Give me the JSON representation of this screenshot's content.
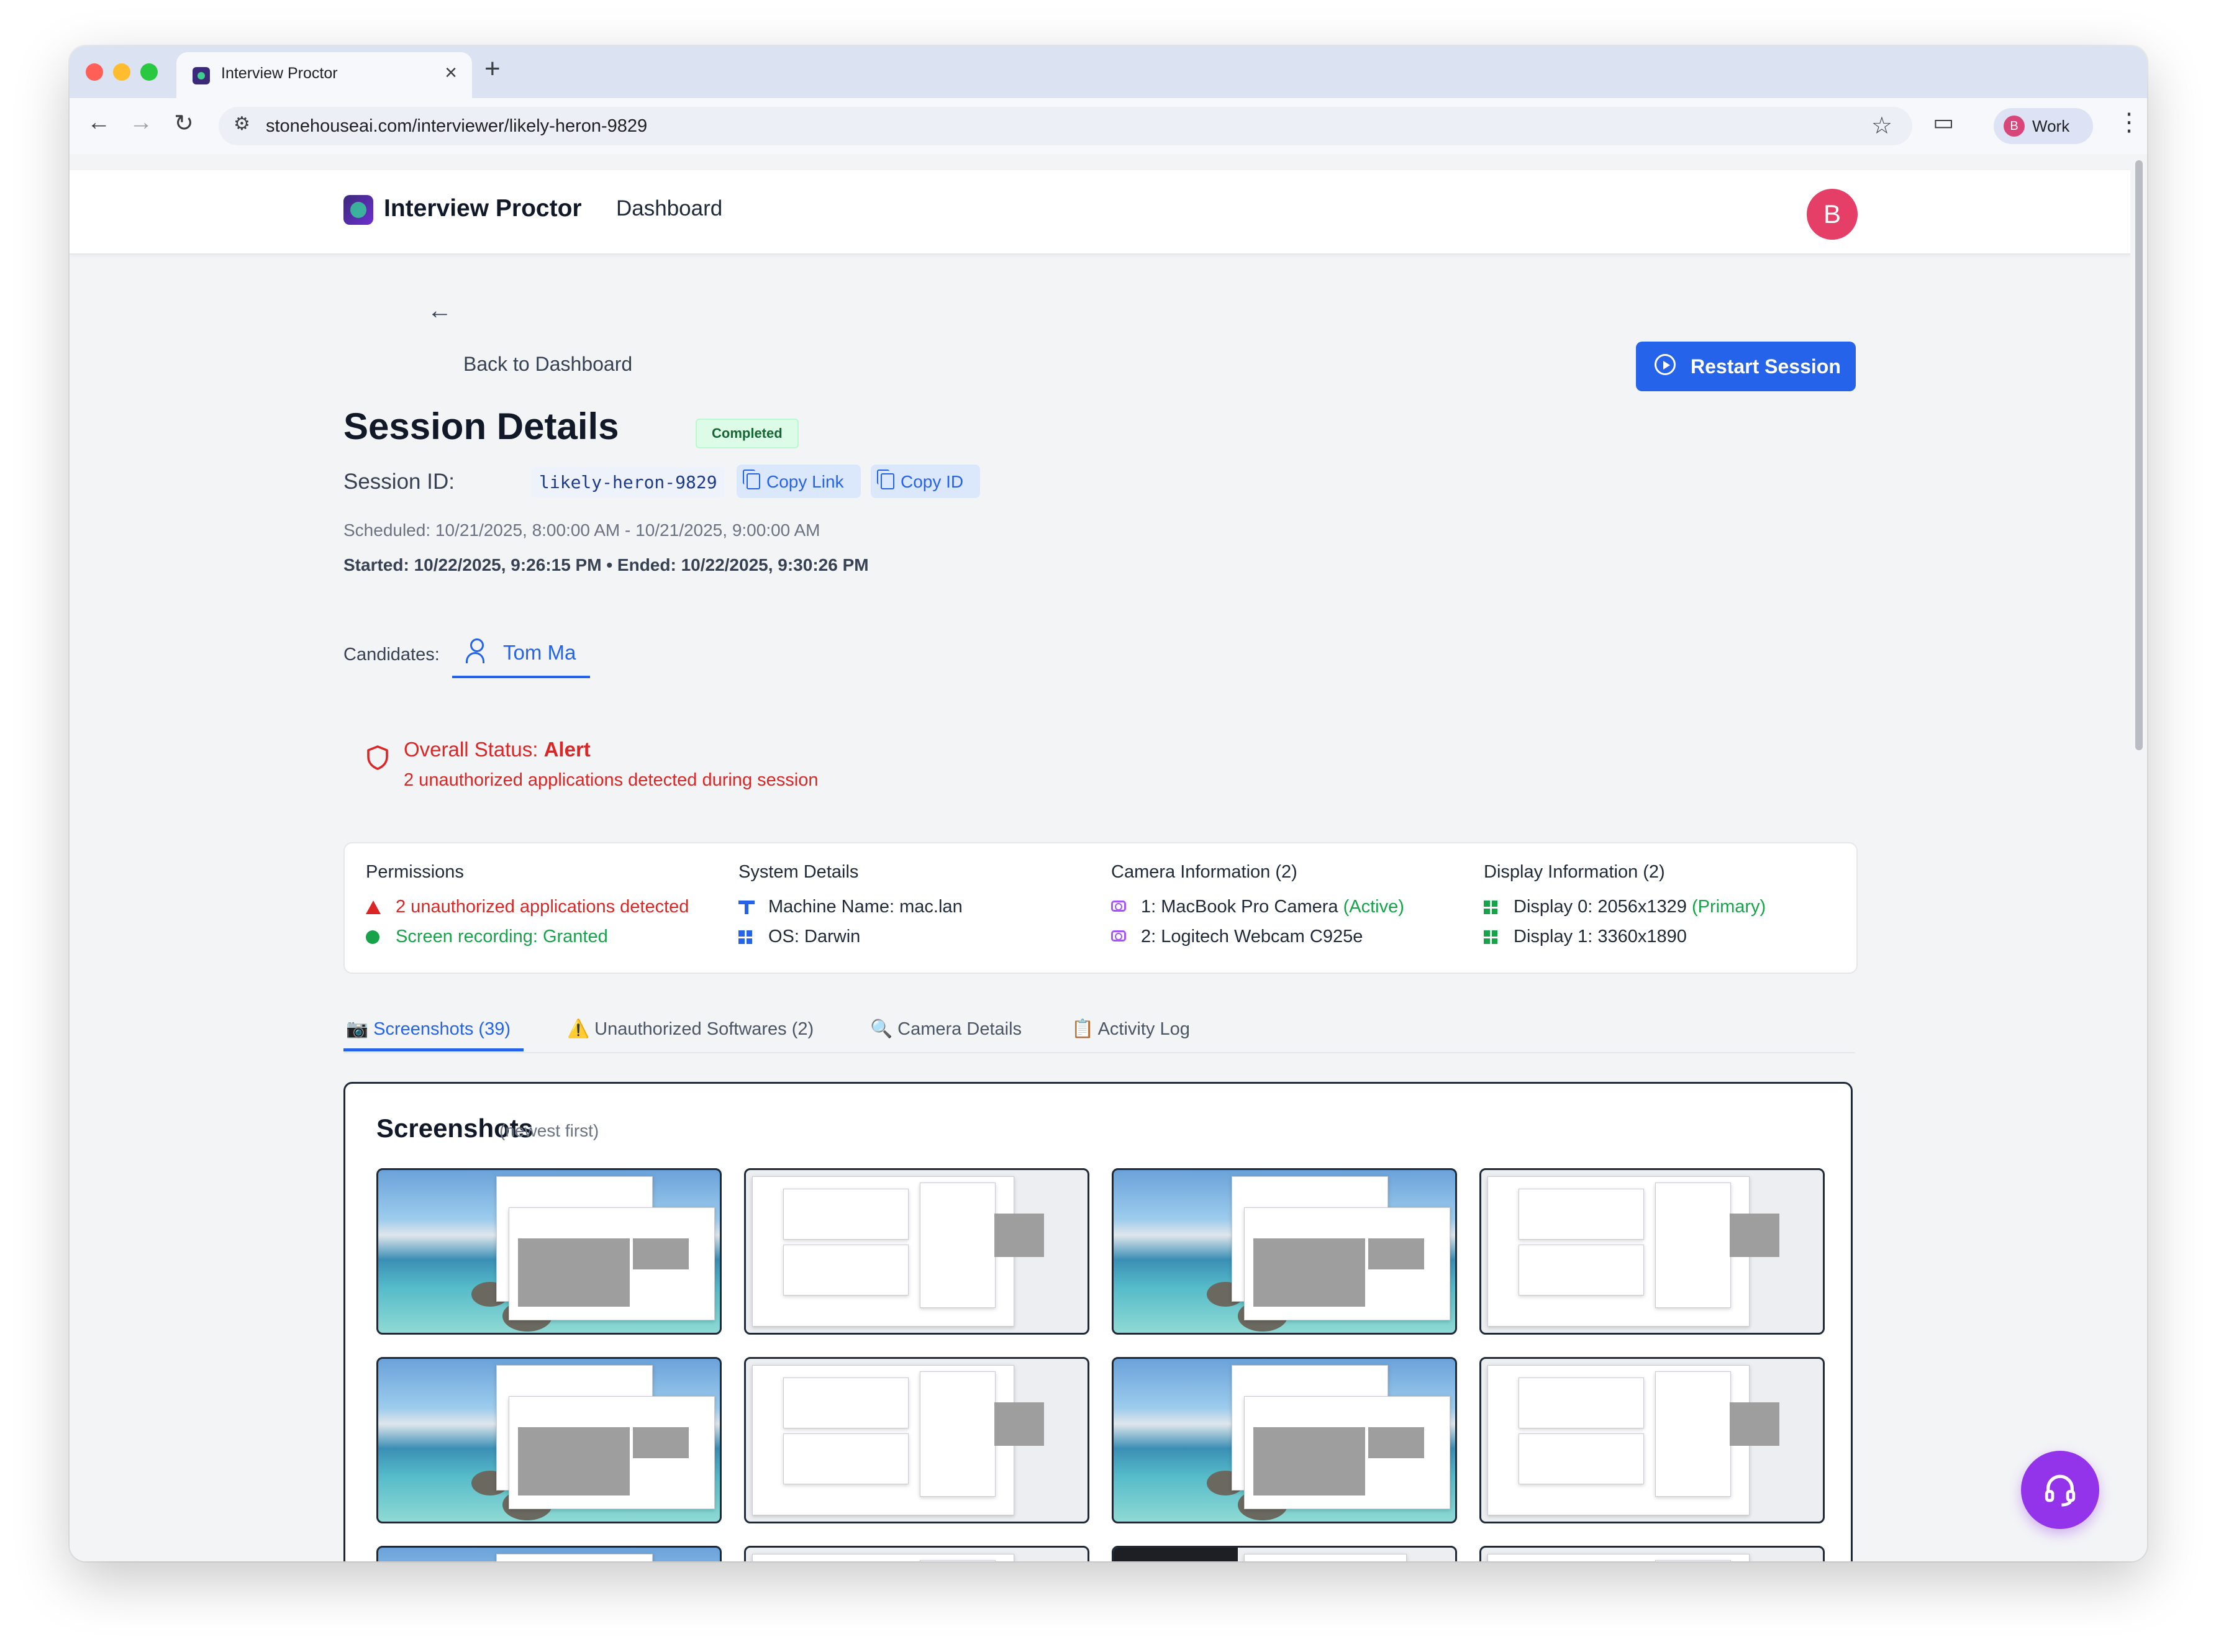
{
  "browser": {
    "tab_title": "Interview Proctor",
    "new_tab": "+",
    "close": "×",
    "url": "stonehouseai.com/interviewer/likely-heron-9829",
    "profile_initial": "B",
    "profile_label": "Work",
    "colors": {
      "close": "#ff5f57",
      "minimize": "#febc2e",
      "maximize": "#28c840"
    }
  },
  "app": {
    "name": "Interview Proctor",
    "nav": "Dashboard",
    "user_initial": "B"
  },
  "header": {
    "back_label": "Back to Dashboard",
    "restart_label": "Restart Session"
  },
  "session": {
    "title": "Session Details",
    "status_badge": "Completed",
    "id_label": "Session ID:",
    "id": "likely-heron-9829",
    "copy_link": "Copy Link",
    "copy_id": "Copy ID",
    "scheduled": "Scheduled: 10/21/2025, 8:00:00 AM - 10/21/2025, 9:00:00 AM",
    "started_ended": "Started: 10/22/2025, 9:26:15 PM • Ended: 10/22/2025, 9:30:26 PM"
  },
  "candidates": {
    "label": "Candidates:",
    "items": [
      "Tom Ma"
    ]
  },
  "overall_status": {
    "label": "Overall Status: ",
    "value": "Alert",
    "detail": "2 unauthorized applications detected during session",
    "color": "#dc2626"
  },
  "info": {
    "permissions": {
      "heading": "Permissions",
      "warning": "2 unauthorized applications detected",
      "granted": "Screen recording: Granted"
    },
    "system": {
      "heading": "System Details",
      "machine_label": "Machine Name:",
      "machine_value": " mac.lan",
      "os_label": "OS:",
      "os_value": " Darwin"
    },
    "camera": {
      "heading": "Camera Information (2)",
      "items": [
        {
          "name": "1: MacBook Pro Camera",
          "tag": " (Active)"
        },
        {
          "name": "2: Logitech Webcam C925e",
          "tag": ""
        }
      ]
    },
    "display": {
      "heading": "Display Information (2)",
      "items": [
        {
          "name": "Display 0: 2056x1329",
          "tag": " (Primary)"
        },
        {
          "name": "Display 1: 3360x1890",
          "tag": ""
        }
      ]
    }
  },
  "tabs": [
    {
      "icon": "📷",
      "label": "Screenshots (39)",
      "active": true
    },
    {
      "icon": "⚠️",
      "label": "Unauthorized Softwares (2)",
      "active": false
    },
    {
      "icon": "🔍",
      "label": "Camera Details",
      "active": false
    },
    {
      "icon": "📋",
      "label": "Activity Log",
      "active": false
    }
  ],
  "screenshots": {
    "title": "Screenshots",
    "subtitle": "(newest first)",
    "thumbnails": [
      "beach",
      "gray",
      "beach",
      "gray",
      "beach",
      "gray",
      "beach",
      "gray",
      "beach",
      "gray",
      "dark",
      "gray"
    ]
  },
  "support_icon": "headset-icon"
}
